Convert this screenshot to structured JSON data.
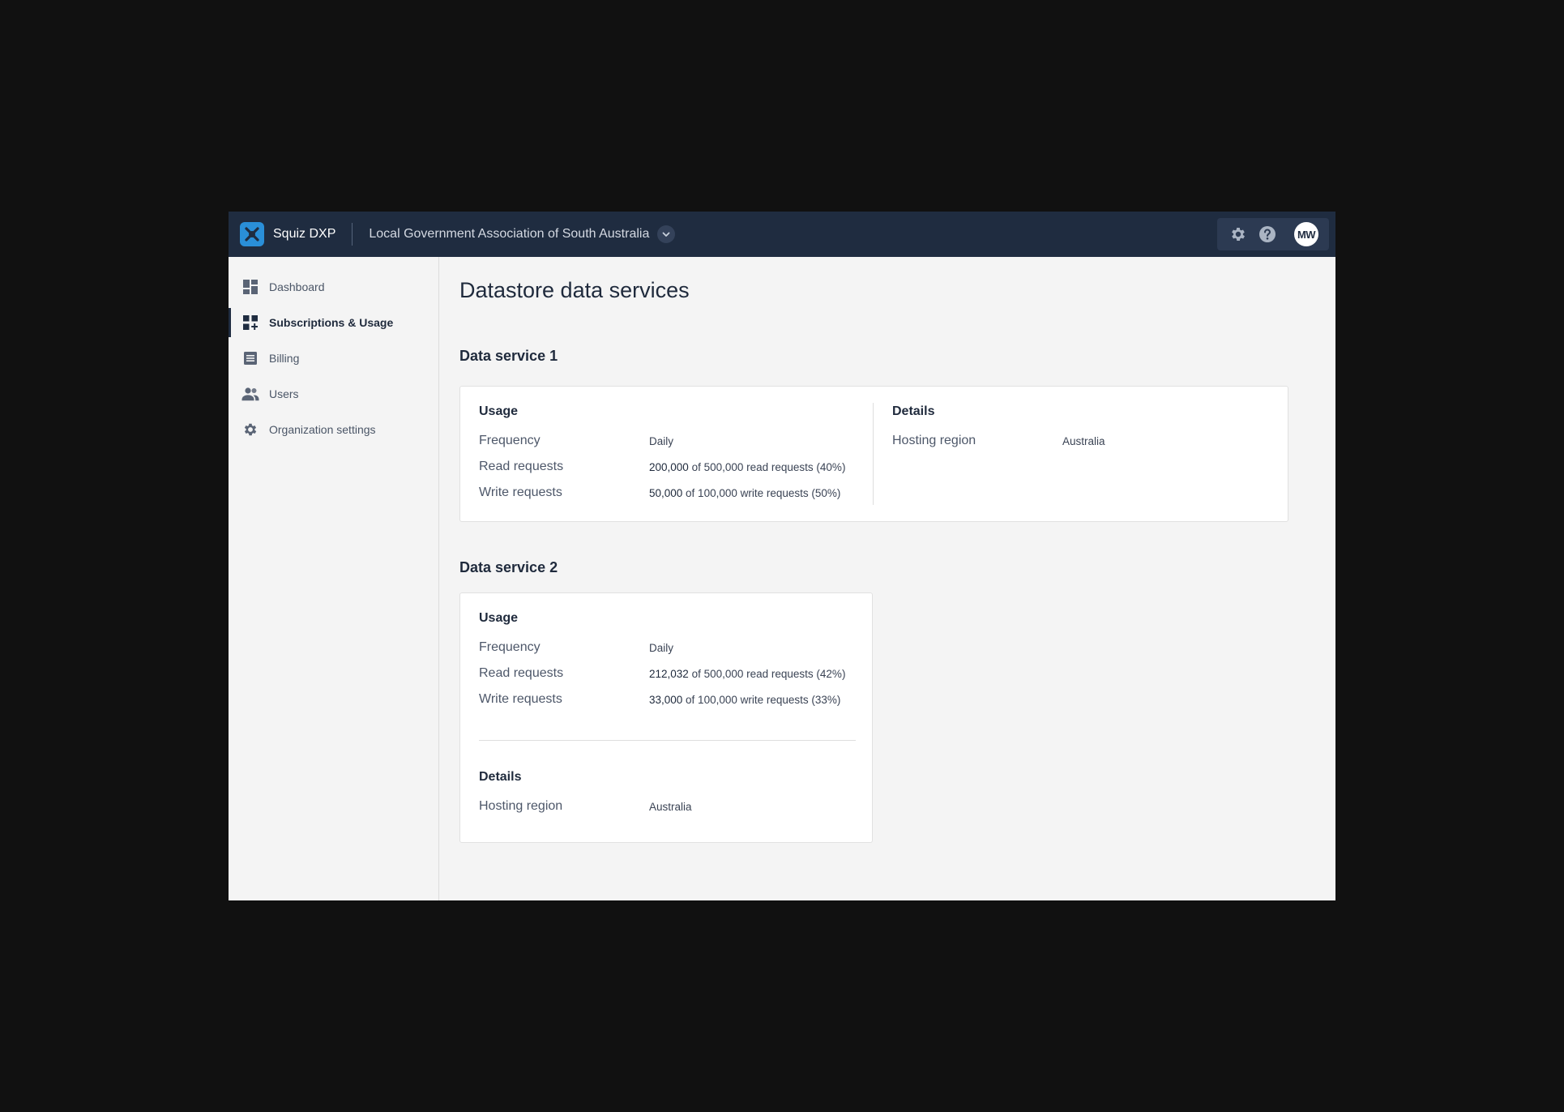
{
  "header": {
    "brand": "Squiz DXP",
    "organization": "Local Government Association of South Australia",
    "avatar_initials": "MW"
  },
  "sidebar": {
    "items": [
      {
        "label": "Dashboard",
        "icon": "dashboard-icon"
      },
      {
        "label": "Subscriptions & Usage",
        "icon": "subscriptions-icon",
        "active": true
      },
      {
        "label": "Billing",
        "icon": "billing-icon"
      },
      {
        "label": "Users",
        "icon": "users-icon"
      },
      {
        "label": "Organization settings",
        "icon": "gear-icon"
      }
    ]
  },
  "main": {
    "title": "Datastore data services",
    "services": [
      {
        "title": "Data service 1",
        "usage": {
          "heading": "Usage",
          "frequency_label": "Frequency",
          "frequency_value": "Daily",
          "read_label": "Read requests",
          "read_used": "200,000",
          "read_rest": " of 500,000 read requests (40%)",
          "write_label": "Write requests",
          "write_used": "50,000",
          "write_rest": " of 100,000 write requests (50%)"
        },
        "details": {
          "heading": "Details",
          "region_label": "Hosting region",
          "region_value": "Australia"
        }
      },
      {
        "title": "Data service 2",
        "usage": {
          "heading": "Usage",
          "frequency_label": "Frequency",
          "frequency_value": "Daily",
          "read_label": "Read requests",
          "read_used": "212,032",
          "read_rest": " of 500,000 read requests (42%)",
          "write_label": "Write requests",
          "write_used": "33,000",
          "write_rest": " of 100,000 write requests (33%)"
        },
        "details": {
          "heading": "Details",
          "region_label": "Hosting region",
          "region_value": "Australia"
        }
      }
    ]
  },
  "colors": {
    "topbar": "#1f2c40",
    "brand_blue": "#2a8fd8",
    "page_bg": "#f4f4f4",
    "card_bg": "#ffffff"
  }
}
